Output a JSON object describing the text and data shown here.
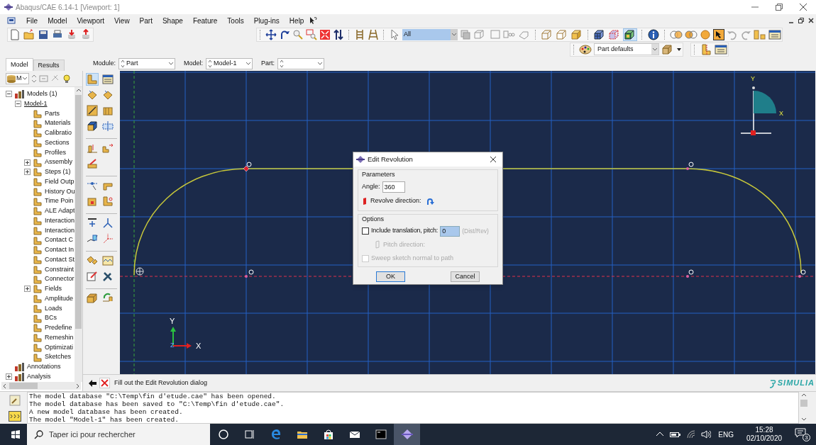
{
  "window": {
    "title": "Abaqus/CAE 6.14-1 [Viewport: 1]"
  },
  "menu": [
    "File",
    "Model",
    "Viewport",
    "View",
    "Part",
    "Shape",
    "Feature",
    "Tools",
    "Plug-ins",
    "Help"
  ],
  "toolbar": {
    "selection_filter": "All",
    "render_style": "Part defaults"
  },
  "tabs": [
    {
      "label": "Model",
      "selected": true
    },
    {
      "label": "Results",
      "selected": false
    }
  ],
  "context_bar": {
    "module": {
      "label": "Module:",
      "value": "Part"
    },
    "model": {
      "label": "Model:",
      "value": "Model-1"
    },
    "part": {
      "label": "Part:"
    }
  },
  "tree": {
    "filter": "M",
    "items": [
      {
        "label": "Models (1)",
        "kind": "group",
        "expanded": true,
        "children": [
          {
            "label": "Model-1",
            "expanded": true,
            "current": true,
            "children": [
              {
                "label": "Parts",
                "kind": "node"
              },
              {
                "label": "Materials",
                "kind": "node"
              },
              {
                "label": "Calibratio",
                "kind": "node"
              },
              {
                "label": "Sections",
                "kind": "node"
              },
              {
                "label": "Profiles",
                "kind": "node"
              },
              {
                "label": "Assembly",
                "kind": "node",
                "expanded": false
              },
              {
                "label": "Steps (1)",
                "kind": "node",
                "expanded": false
              },
              {
                "label": "Field Outp",
                "kind": "node"
              },
              {
                "label": "History Ou",
                "kind": "node"
              },
              {
                "label": "Time Poin",
                "kind": "node"
              },
              {
                "label": "ALE Adapt",
                "kind": "node"
              },
              {
                "label": "Interaction",
                "kind": "node"
              },
              {
                "label": "Interaction",
                "kind": "node"
              },
              {
                "label": "Contact C",
                "kind": "node"
              },
              {
                "label": "Contact In",
                "kind": "node"
              },
              {
                "label": "Contact St",
                "kind": "node"
              },
              {
                "label": "Constraint",
                "kind": "node"
              },
              {
                "label": "Connector",
                "kind": "node"
              },
              {
                "label": "Fields",
                "kind": "node",
                "expanded": false
              },
              {
                "label": "Amplitude",
                "kind": "node"
              },
              {
                "label": "Loads",
                "kind": "node"
              },
              {
                "label": "BCs",
                "kind": "node"
              },
              {
                "label": "Predefine",
                "kind": "node"
              },
              {
                "label": "Remeshin",
                "kind": "node"
              },
              {
                "label": "Optimizati",
                "kind": "node"
              },
              {
                "label": "Sketches",
                "kind": "node"
              }
            ]
          }
        ]
      },
      {
        "label": "Annotations",
        "kind": "group"
      },
      {
        "label": "Analysis",
        "kind": "group",
        "expanded": false
      }
    ]
  },
  "viewport": {
    "view_cube": {
      "y": "Y",
      "x": "X"
    },
    "triad": {
      "y": "Y",
      "z": "Z",
      "x": "X"
    }
  },
  "dialog": {
    "title": "Edit Revolution",
    "parameters": {
      "heading": "Parameters",
      "angle_label": "Angle:",
      "angle": "360",
      "direction_label": "Revolve direction:"
    },
    "options": {
      "heading": "Options",
      "translation": {
        "label": "Include translation, pitch:",
        "checked": false,
        "disabled": false
      },
      "pitch": "0",
      "pitch_unit": "(Dist/Rev)",
      "pitch_direction": {
        "label": "Pitch direction:",
        "disabled": true
      },
      "sweep": {
        "label": "Sweep sketch normal to path",
        "checked": false,
        "disabled": true
      }
    },
    "buttons": [
      {
        "label": "OK",
        "default": true
      },
      {
        "label": "Cancel",
        "default": false
      }
    ]
  },
  "prompt": "Fill out the Edit Revolution dialog",
  "brand": "SIMULIA",
  "messages": [
    "The model database \"C:\\Temp\\fin d'etude.cae\" has been opened.",
    "The model database has been saved to \"C:\\Temp\\fin d'etude.cae\".",
    "A new model database has been created.",
    "The model \"Model-1\" has been created."
  ],
  "taskbar": {
    "search_placeholder": "Taper ici pour rechercher",
    "language": "ENG",
    "time": "15:28",
    "date": "02/10/2020",
    "notifications": "3"
  }
}
